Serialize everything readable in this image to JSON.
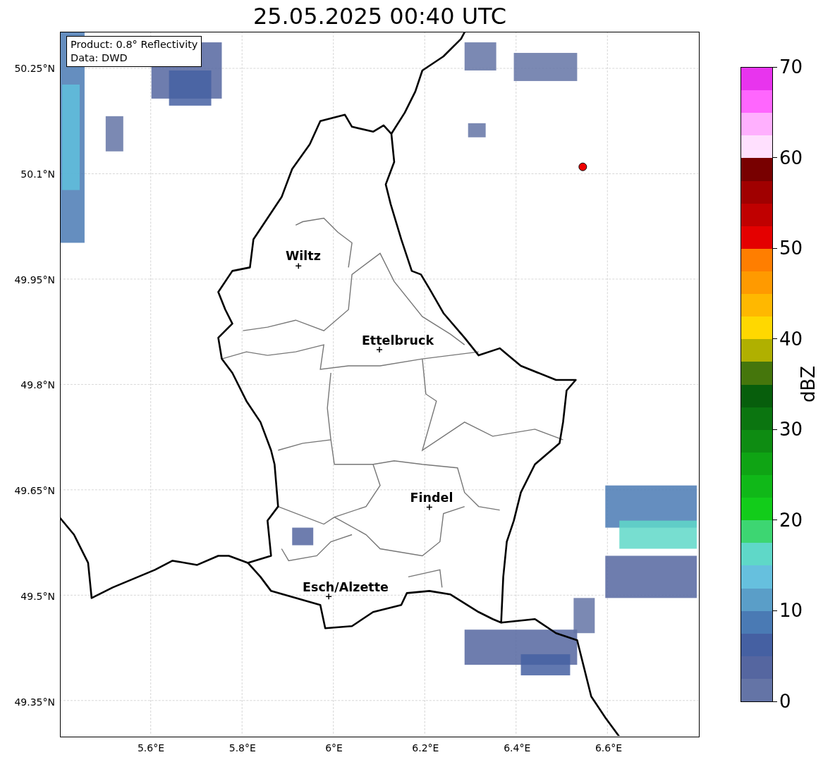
{
  "title": "25.05.2025 00:40 UTC",
  "annotation": [
    "Product: 0.8° Reflectivity",
    "Data: DWD"
  ],
  "lat_ticks": [
    "50.25°N",
    "50.1°N",
    "49.95°N",
    "49.8°N",
    "49.65°N",
    "49.5°N",
    "49.35°N"
  ],
  "lon_ticks": [
    "5.6°E",
    "5.8°E",
    "6°E",
    "6.2°E",
    "6.4°E",
    "6.6°E"
  ],
  "cities": [
    {
      "name": "Wiltz"
    },
    {
      "name": "Ettelbruck"
    },
    {
      "name": "Findel"
    },
    {
      "name": "Esch/Alzette"
    }
  ],
  "colorbar": {
    "label": "dBZ",
    "ticks": [
      "70",
      "60",
      "50",
      "40",
      "30",
      "20",
      "10",
      "0"
    ],
    "bands": [
      {
        "color": "#e834ee"
      },
      {
        "color": "#ff66fe"
      },
      {
        "color": "#ffb0fe"
      },
      {
        "color": "#ffe0fe"
      },
      {
        "color": "#780000"
      },
      {
        "color": "#a00000"
      },
      {
        "color": "#c00000"
      },
      {
        "color": "#e40000"
      },
      {
        "color": "#ff7e00"
      },
      {
        "color": "#ff9a00"
      },
      {
        "color": "#ffb800"
      },
      {
        "color": "#ffd800"
      },
      {
        "color": "#b0b000"
      },
      {
        "color": "#45760c"
      },
      {
        "color": "#075e0c"
      },
      {
        "color": "#0b7510"
      },
      {
        "color": "#0e8c12"
      },
      {
        "color": "#0fa414"
      },
      {
        "color": "#10b818"
      },
      {
        "color": "#12cc1a"
      },
      {
        "color": "#3dd672"
      },
      {
        "color": "#5fd8c8"
      },
      {
        "color": "#66c0de"
      },
      {
        "color": "#5a9ec8"
      },
      {
        "color": "#4a7ab4"
      },
      {
        "color": "#4560a2"
      },
      {
        "color": "#5566a0"
      },
      {
        "color": "#6474a6"
      }
    ]
  }
}
